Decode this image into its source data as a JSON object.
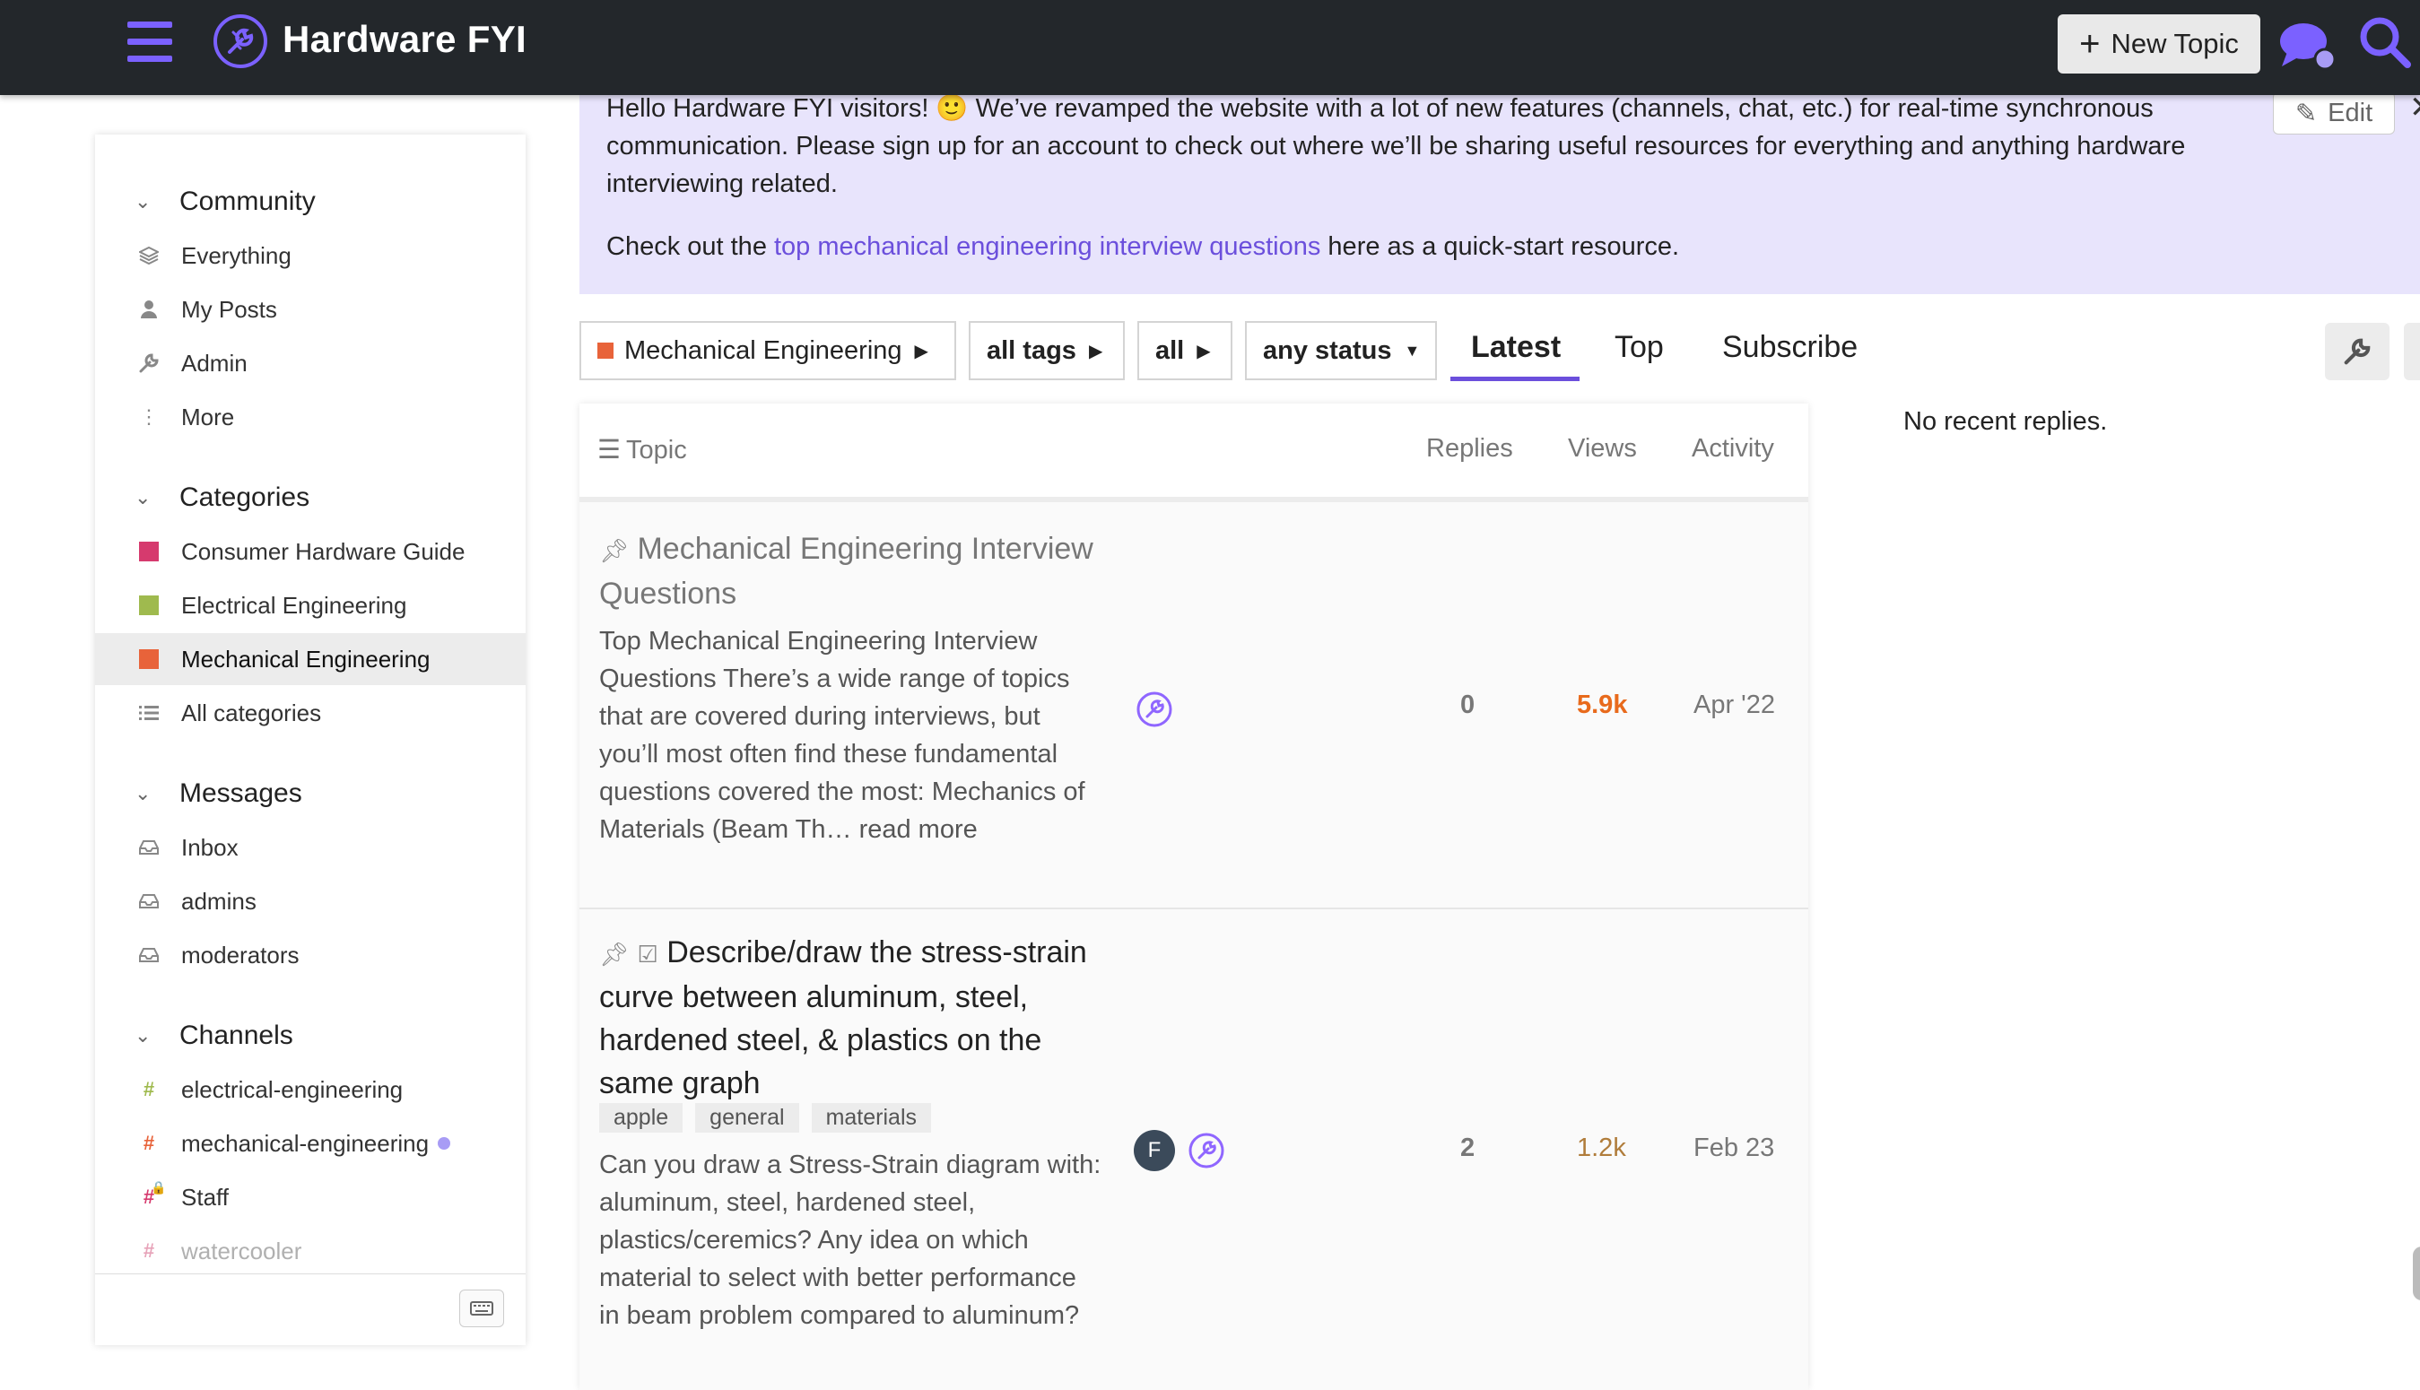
{
  "header": {
    "site_title": "Hardware FYI",
    "new_topic_label": "New Topic",
    "brand_color": "#7b61ff"
  },
  "sidebar": {
    "community": {
      "title": "Community",
      "items": [
        {
          "label": "Everything",
          "icon": "layers-icon"
        },
        {
          "label": "My Posts",
          "icon": "user-icon"
        },
        {
          "label": "Admin",
          "icon": "wrench-icon"
        },
        {
          "label": "More",
          "icon": "ellipsis-vertical-icon"
        }
      ]
    },
    "categories": {
      "title": "Categories",
      "items": [
        {
          "label": "Consumer Hardware Guide",
          "color": "#d63a6e"
        },
        {
          "label": "Electrical Engineering",
          "color": "#9fba4e"
        },
        {
          "label": "Mechanical Engineering",
          "color": "#e8633a",
          "active": true
        },
        {
          "label": "All categories",
          "icon": "list-icon"
        }
      ]
    },
    "messages": {
      "title": "Messages",
      "items": [
        {
          "label": "Inbox",
          "icon": "inbox-icon"
        },
        {
          "label": "admins",
          "icon": "inbox-icon"
        },
        {
          "label": "moderators",
          "icon": "inbox-icon"
        }
      ]
    },
    "channels": {
      "title": "Channels",
      "items": [
        {
          "label": "electrical-engineering",
          "hash_color": "#9fba4e"
        },
        {
          "label": "mechanical-engineering",
          "hash_color": "#e8633a",
          "unread": true
        },
        {
          "label": "Staff",
          "hash_color": "#d63a6e",
          "locked": true
        },
        {
          "label": "watercooler",
          "hash_color": "#d63a6e"
        }
      ]
    }
  },
  "banner": {
    "line1": "Hello Hardware FYI visitors! 🙂 We’ve revamped the website with a lot of new features (channels, chat, etc.) for real-time synchronous communication. Please sign up for an account to check out where we’ll be sharing useful resources for everything and anything hardware interviewing related.",
    "line2_before": "Check out the ",
    "line2_link": "top mechanical engineering interview questions",
    "line2_after": " here as a quick-start resource.",
    "edit_label": "Edit",
    "background": "#e8e4fc"
  },
  "filters": {
    "category": "Mechanical Engineering",
    "tags": "all tags",
    "all": "all",
    "status": "any status"
  },
  "nav_tabs": {
    "latest": "Latest",
    "top": "Top",
    "subscribe": "Subscribe"
  },
  "table": {
    "headers": {
      "topic": "Topic",
      "replies": "Replies",
      "views": "Views",
      "activity": "Activity"
    },
    "topics": [
      {
        "title": "Mechanical Engineering Interview Questions",
        "excerpt": "Top Mechanical Engineering Interview Questions There’s a wide range of topics that are covered during interviews, but you’ll most often find these fundamental questions covered the most: Mechanics of Materials (Beam Th…",
        "read_more": "read more",
        "replies": "0",
        "views": "5.9k",
        "activity": "Apr '22",
        "pinned": true
      },
      {
        "title": "Describe/draw the stress-strain curve between aluminum, steel, hardened steel, & plastics on the same graph",
        "tags": [
          "apple",
          "general",
          "materials"
        ],
        "excerpt": "Can you draw a Stress-Strain diagram with: aluminum, steel, hardened steel, plastics/ceremics? Any idea on which material to select with better performance in beam problem compared to aluminum?",
        "avatar_letter": "F",
        "replies": "2",
        "views": "1.2k",
        "activity": "Feb 23",
        "pinned": true,
        "solved": true
      }
    ]
  },
  "right_panel": {
    "no_recent_replies": "No recent replies."
  }
}
